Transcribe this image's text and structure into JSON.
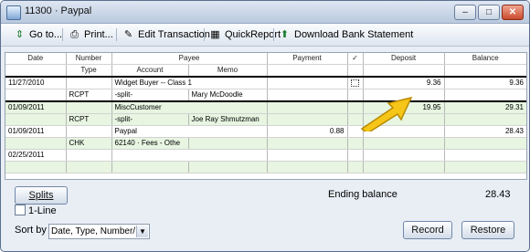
{
  "window": {
    "title": "11300 · Paypal"
  },
  "toolbar": {
    "goto": "Go to...",
    "print": "Print...",
    "edit": "Edit Transaction",
    "quickreport": "QuickReport",
    "download": "Download Bank Statement"
  },
  "columns": {
    "date": "Date",
    "number": "Number",
    "type": "Type",
    "payee": "Payee",
    "account": "Account",
    "memo": "Memo",
    "payment": "Payment",
    "check": "✓",
    "deposit": "Deposit",
    "balance": "Balance"
  },
  "rows": [
    {
      "date": "11/27/2010",
      "number": "",
      "payee": "Widget Buyer -- Class 1",
      "payment": "",
      "deposit": "9.36",
      "balance": "9.36",
      "type": "RCPT",
      "account": "-split-",
      "memo": "Mary McDoodle"
    },
    {
      "date": "01/09/2011",
      "number": "",
      "payee": "MiscCustomer",
      "payment": "",
      "deposit": "19.95",
      "balance": "29.31",
      "type": "RCPT",
      "account": "-split-",
      "memo": "Joe Ray Shmutzman"
    },
    {
      "date": "01/09/2011",
      "number": "",
      "payee": "Paypal",
      "payment": "0.88",
      "deposit": "",
      "balance": "28.43",
      "type": "CHK",
      "account": "62140 · Fees - Othe",
      "memo": ""
    },
    {
      "date": "02/25/2011",
      "number": "",
      "payee": "",
      "payment": "",
      "deposit": "",
      "balance": "",
      "type": "",
      "account": "",
      "memo": ""
    }
  ],
  "footer": {
    "splits": "Splits",
    "ending_label": "Ending balance",
    "ending_value": "28.43",
    "oneline": "1-Line",
    "sortby": "Sort by",
    "sort_value": "Date, Type, Number/...",
    "record": "Record",
    "restore": "Restore"
  }
}
